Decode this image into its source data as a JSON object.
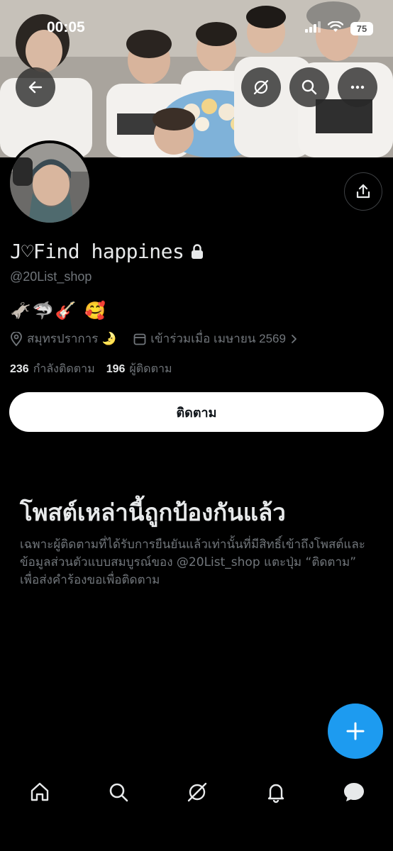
{
  "status_bar": {
    "time": "00:05",
    "battery": "75"
  },
  "banner": {
    "description_icon": "photo-banner"
  },
  "profile": {
    "display_name": "J♡Find happines",
    "handle": "@20List_shop",
    "bio": "🫏🦈🎸 🥰",
    "location": "สมุทรปราการ 🌛",
    "joined": "เข้าร่วมเมื่อ เมษายน 2569",
    "following_count": "236",
    "following_label": "กำลังติดตาม",
    "followers_count": "196",
    "followers_label": "ผู้ติดตาม",
    "follow_button": "ติดตาม"
  },
  "protected": {
    "title": "โพสต์เหล่านี้ถูกป้องกันแล้ว",
    "body": "เฉพาะผู้ติดตามที่ได้รับการยืนยันแล้วเท่านั้นที่มีสิทธิ์เข้าถึงโพสต์และข้อมูลส่วนตัวแบบสมบูรณ์ของ @20List_shop แตะปุ่ม “ติดตาม” เพื่อส่งคำร้องขอเพื่อติดตาม"
  },
  "colors": {
    "accent": "#1d9bf0",
    "background": "#000000",
    "muted_text": "#71767b",
    "primary_text": "#e7e9ea"
  },
  "nav": [
    "home-icon",
    "search-icon",
    "grok-icon",
    "bell-icon",
    "messages-icon"
  ]
}
